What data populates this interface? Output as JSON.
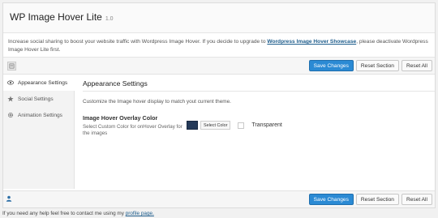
{
  "header": {
    "title": "WP Image Hover Lite",
    "version": "1.0"
  },
  "notice": {
    "before": "Increase social sharing to boost your website traffic with Wordpress Image Hover. If you decide to upgrade to ",
    "link": "Wordpress Image Hover Showcase",
    "after": ", please deactivate Wordpress Image Hover Lite first."
  },
  "toolbar": {
    "save_label": "Save Changes",
    "reset_section_label": "Reset Section",
    "reset_all_label": "Reset All"
  },
  "sidebar": {
    "items": [
      {
        "label": "Appearance Settings",
        "icon": "eye-icon",
        "active": true
      },
      {
        "label": "Social Settings",
        "icon": "star-icon",
        "active": false
      },
      {
        "label": "Animation Settings",
        "icon": "gear-icon",
        "active": false
      }
    ]
  },
  "main": {
    "title": "Appearance Settings",
    "description": "Customize the Image hover display to match yout current theme.",
    "field": {
      "title": "Image Hover Overlay Color",
      "subtitle": "Select Custom Color for onHover Overlay for the images",
      "color": "#253a59",
      "select_label": "Select Color",
      "transparent_label": "Transparent",
      "transparent_checked": false
    }
  },
  "help": {
    "text": "If you need any help feel free to contact me using my ",
    "link": "profile page."
  },
  "colors": {
    "primary": "#2b8ad4",
    "link": "#1e5d8c"
  }
}
